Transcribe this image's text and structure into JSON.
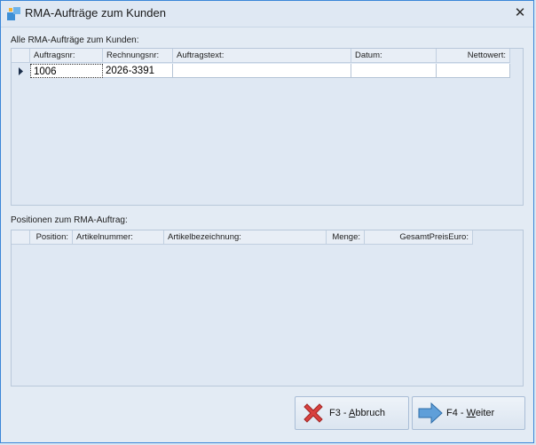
{
  "window": {
    "title": "RMA-Aufträge zum Kunden",
    "close_glyph": "✕"
  },
  "orders": {
    "label": "Alle RMA-Aufträge zum Kunden:",
    "columns": [
      "Auftragsnr:",
      "Rechnungsnr:",
      "Auftragstext:",
      "Datum:",
      "Nettowert:"
    ],
    "rows": [
      {
        "auftragsnr": "1006",
        "rechnungsnr": "2026-3391",
        "auftragstext": "",
        "datum": "",
        "nettowert": ""
      }
    ]
  },
  "positions": {
    "label": "Positionen zum RMA-Auftrag:",
    "columns": [
      "Position:",
      "Artikelnummer:",
      "Artikelbezeichnung:",
      "Menge:",
      "GesamtPreisEuro:"
    ]
  },
  "buttons": {
    "cancel": {
      "prefix": "F3 - ",
      "hotkey": "A",
      "rest": "bbruch",
      "icon": "red-x-icon"
    },
    "next": {
      "prefix": "F4 - ",
      "hotkey": "W",
      "rest": "eiter",
      "icon": "blue-arrow-icon"
    }
  }
}
